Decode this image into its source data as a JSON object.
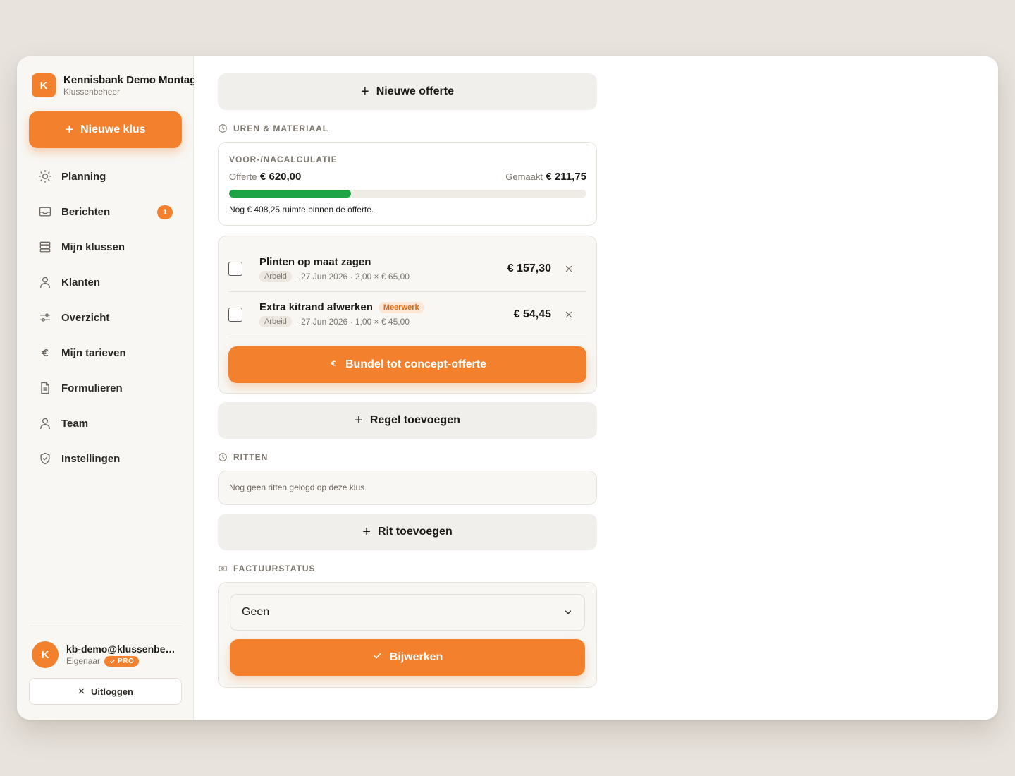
{
  "brand": {
    "logo_letter": "K",
    "name": "Kennisbank Demo Montage",
    "subtitle": "Klussenbeheer"
  },
  "actions": {
    "new_job": "Nieuwe klus"
  },
  "nav": [
    {
      "label": "Planning",
      "icon": "sun-icon"
    },
    {
      "label": "Berichten",
      "icon": "inbox-icon",
      "badge": "1"
    },
    {
      "label": "Mijn klussen",
      "icon": "stack-icon"
    },
    {
      "label": "Klanten",
      "icon": "person-icon"
    },
    {
      "label": "Overzicht",
      "icon": "sliders-icon"
    },
    {
      "label": "Mijn tarieven",
      "icon": "euro-icon"
    },
    {
      "label": "Formulieren",
      "icon": "document-icon"
    },
    {
      "label": "Team",
      "icon": "person-icon"
    },
    {
      "label": "Instellingen",
      "icon": "shield-icon"
    }
  ],
  "user": {
    "avatar_letter": "K",
    "email": "kb-demo@klussenbeheer.nl",
    "role": "Eigenaar",
    "badge": "PRO"
  },
  "logout": "Uitloggen",
  "main": {
    "new_quote": "Nieuwe offerte",
    "hours_section": "UREN & MATERIAAL",
    "calc": {
      "title": "VOOR-/NACALCULATIE",
      "offer_label": "Offerte",
      "offer_value": "€ 620,00",
      "made_label": "Gemaakt",
      "made_value": "€ 211,75",
      "progress": 0.3415,
      "note": "Nog € 408,25 ruimte binnen de offerte."
    },
    "lines": [
      {
        "title": "Plinten op maat zagen",
        "tag": "Arbeid",
        "meta": "· 27 Jun 2026 · 2,00 × € 65,00",
        "amount": "€ 157,30"
      },
      {
        "title": "Extra kitrand afwerken",
        "badge": "Meerwerk",
        "tag": "Arbeid",
        "meta": "· 27 Jun 2026 · 1,00 × € 45,00",
        "amount": "€ 54,45"
      }
    ],
    "bundle_button": "Bundel tot concept-offerte",
    "add_line": "Regel toevoegen",
    "rides_section": "RITTEN",
    "rides_empty": "Nog geen ritten gelogd op deze klus.",
    "add_ride": "Rit toevoegen",
    "invoice_section": "FACTUURSTATUS",
    "invoice_status": "Geen",
    "update_button": "Bijwerken"
  },
  "colors": {
    "accent": "#f2802c",
    "progress": "#1ea446",
    "background": "#e8e3dd"
  }
}
